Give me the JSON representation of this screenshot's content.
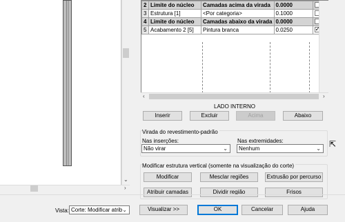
{
  "grid": {
    "rows": [
      {
        "n": "2",
        "function": "Limite do núcleo",
        "material": "Camadas acima da virada",
        "thickness": "0.0000",
        "checked": false,
        "bold": true
      },
      {
        "n": "3",
        "function": "Estrutura [1]",
        "material": "<Por categoria>",
        "thickness": "0.1000",
        "checked": false,
        "bold": false
      },
      {
        "n": "4",
        "function": "Limite do núcleo",
        "material": "Camadas abaixo da virada",
        "thickness": "0.0000",
        "checked": false,
        "bold": true
      },
      {
        "n": "5",
        "function": "Acabamento 2 [5]",
        "material": "Pintura branca",
        "thickness": "0.0250",
        "checked": true,
        "bold": false
      }
    ]
  },
  "side_label": "LADO INTERNO",
  "layer_buttons": {
    "insert": "Inserir",
    "delete": "Excluir",
    "up": "Acima",
    "down": "Abaixo"
  },
  "wrap": {
    "title": "Virada do revestimento-padrão",
    "inserts_label": "Nas inserções:",
    "inserts_value": "Não virar",
    "ends_label": "Nas extremidades:",
    "ends_value": "Nenhum"
  },
  "vertical": {
    "title": "Modificar estrutura vertical (somente na visualização do corte)",
    "modify": "Modificar",
    "merge": "Mesclar regiões",
    "sweeps": "Extrusão por percurso",
    "assign": "Atribuir camadas",
    "split": "Dividir região",
    "reveals": "Frisos"
  },
  "footer": {
    "view_label": "Vista:",
    "view_value": "Corte: Modificar atrib",
    "preview": "Visualizar >>",
    "ok": "OK",
    "cancel": "Cancelar",
    "help": "Ajuda"
  }
}
